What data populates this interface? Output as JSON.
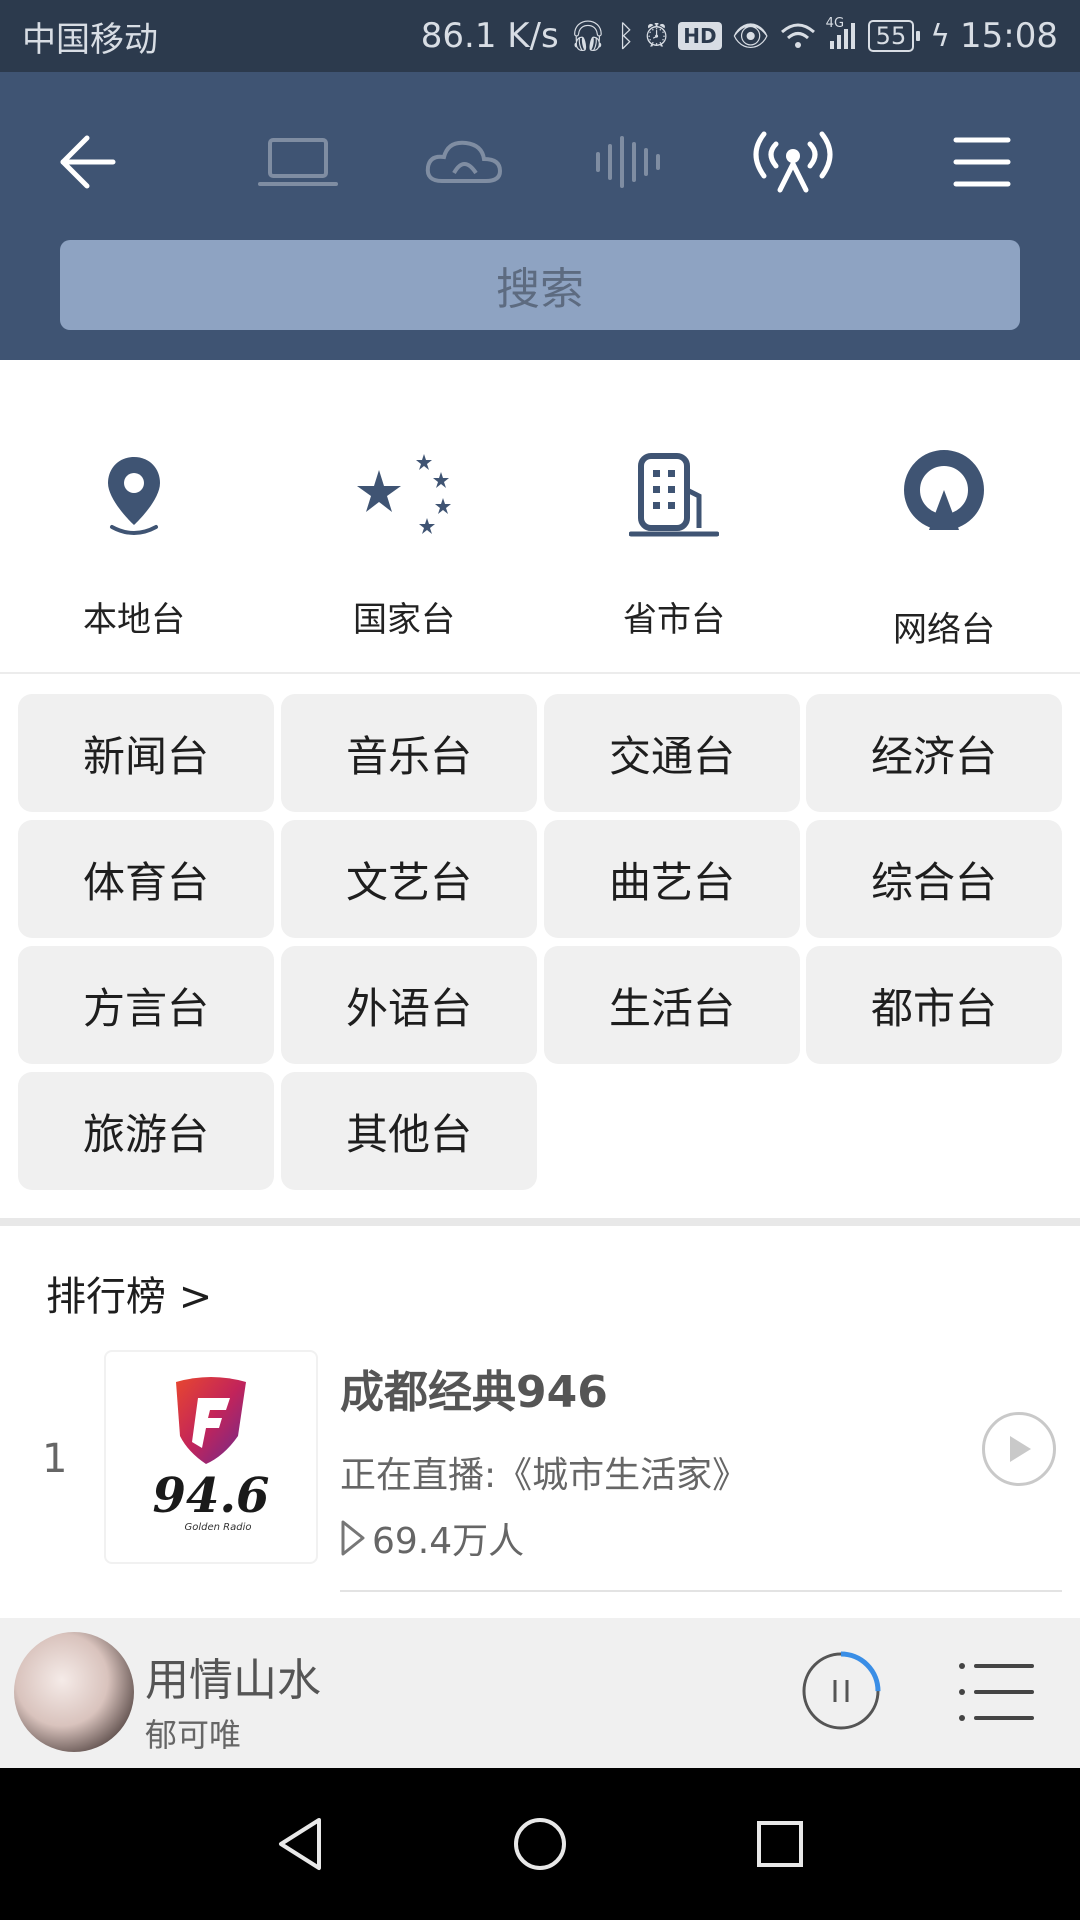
{
  "status_bar": {
    "carrier": "中国移动",
    "speed": "86.1 K/s",
    "hd": "HD",
    "network": "4G",
    "battery": "55",
    "time": "15:08"
  },
  "header": {
    "search_placeholder": "搜索",
    "active_tab": "radio"
  },
  "categories": [
    {
      "label": "本地台",
      "icon": "location-pin-icon"
    },
    {
      "label": "国家台",
      "icon": "national-stars-icon"
    },
    {
      "label": "省市台",
      "icon": "building-icon"
    },
    {
      "label": "网络台",
      "icon": "network-radio-icon"
    }
  ],
  "genres": [
    "新闻台",
    "音乐台",
    "交通台",
    "经济台",
    "体育台",
    "文艺台",
    "曲艺台",
    "综合台",
    "方言台",
    "外语台",
    "生活台",
    "都市台",
    "旅游台",
    "其他台"
  ],
  "ranking": {
    "title": "排行榜 >",
    "items": [
      {
        "rank": "1",
        "name": "成都经典946",
        "live": "正在直播:《城市生活家》",
        "listeners": "69.4万人",
        "logo_text": "94.6",
        "logo_sub": "Golden Radio"
      }
    ]
  },
  "player": {
    "song": "用情山水",
    "artist": "郁可唯",
    "progress": 0.25
  },
  "colors": {
    "header": "#3f5473",
    "status_bar": "#2c3a4d",
    "accent": "#3a8ee6"
  }
}
